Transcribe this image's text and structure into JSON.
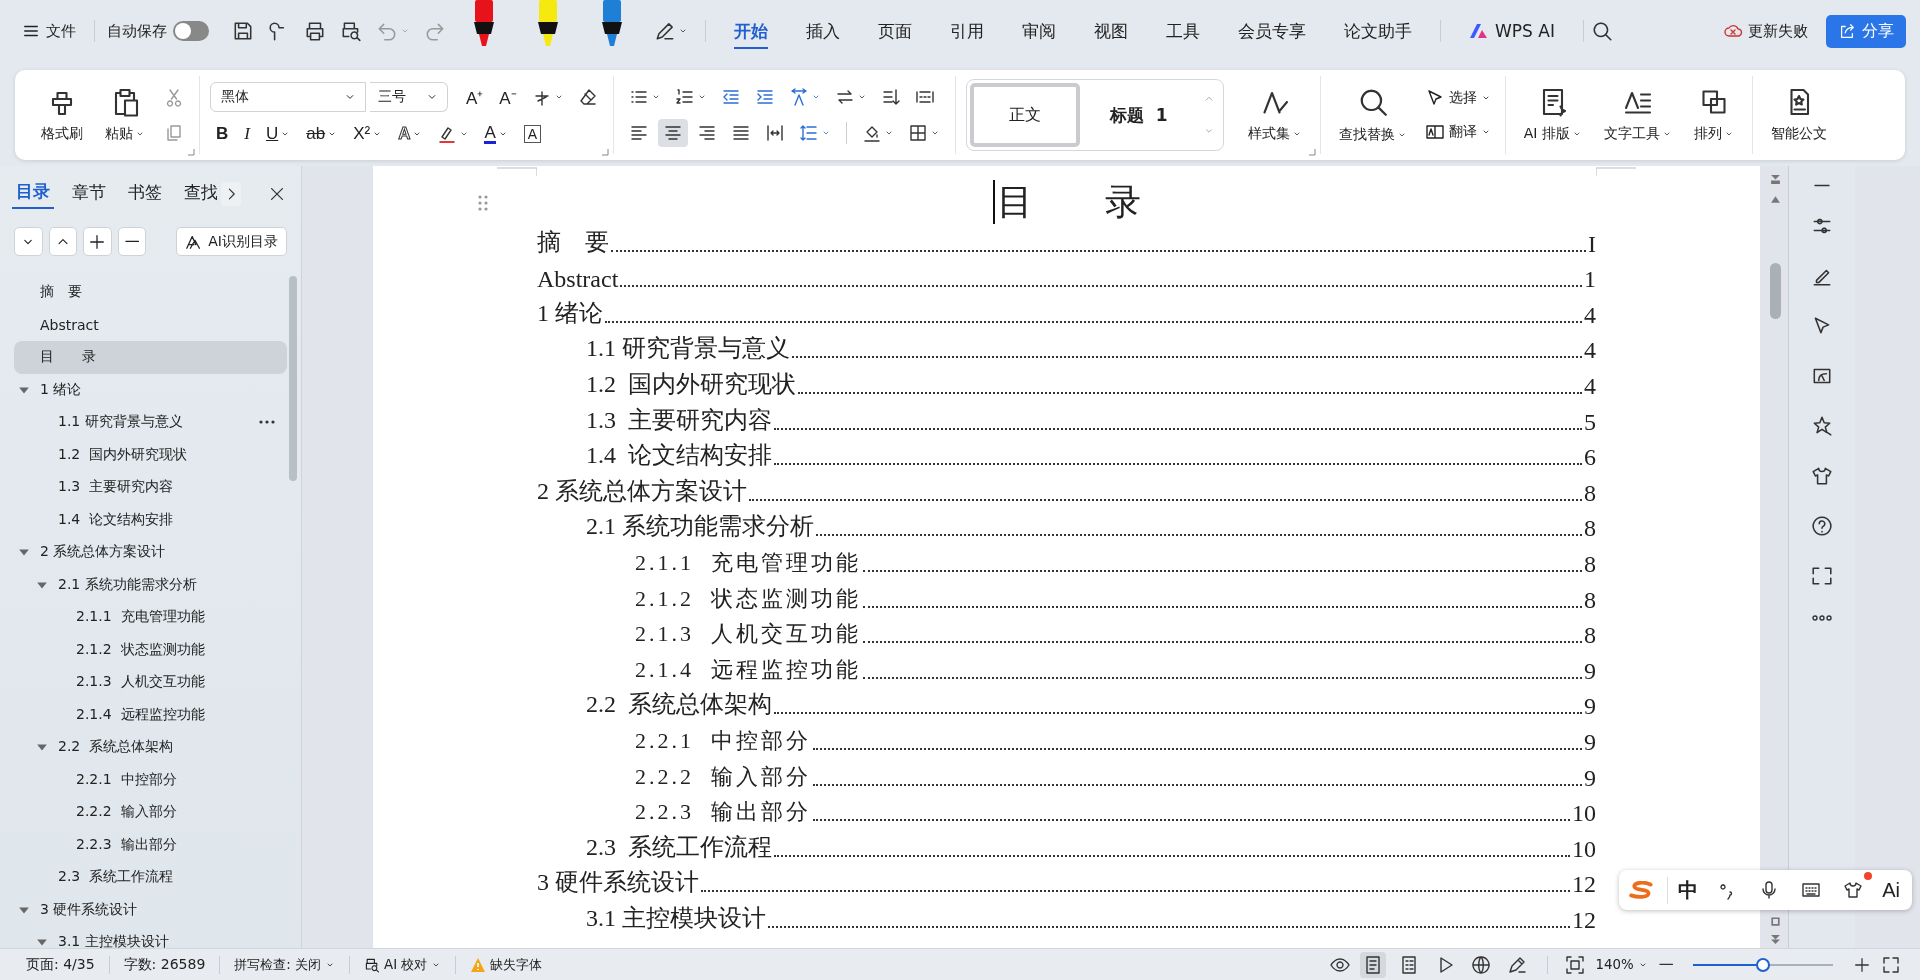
{
  "topbar": {
    "menu": "文件",
    "autosave": {
      "label": "自动保存",
      "on": false
    },
    "pens": [
      {
        "color": "#e8121b"
      },
      {
        "color": "#f5e90f"
      },
      {
        "color": "#1f7fd6"
      }
    ],
    "tabs": [
      {
        "label": "开始",
        "kind": "text",
        "selected": true
      },
      {
        "label": "插入",
        "kind": "text",
        "selected": false
      },
      {
        "label": "页面",
        "kind": "text",
        "selected": false
      },
      {
        "label": "引用",
        "kind": "text",
        "selected": false
      },
      {
        "label": "审阅",
        "kind": "text",
        "selected": false
      },
      {
        "label": "视图",
        "kind": "text",
        "selected": false
      },
      {
        "label": "工具",
        "kind": "text",
        "selected": false
      },
      {
        "label": "会员专享",
        "kind": "text",
        "selected": false
      },
      {
        "label": "论文助手",
        "kind": "text",
        "selected": false
      },
      {
        "label": "WPS AI",
        "kind": "ai",
        "selected": false
      }
    ],
    "sync_status": "更新失败",
    "share": "分享"
  },
  "ribbon": {
    "format_painter": "格式刷",
    "paste": "粘贴",
    "font": {
      "value": "黑体"
    },
    "size": {
      "value": "三号"
    },
    "size_buttons": [
      {
        "text": "A⁺"
      },
      {
        "text": "A⁻"
      }
    ],
    "font_buttons": [
      {
        "kind": "bold",
        "text": "B"
      },
      {
        "kind": "italic",
        "text": "I"
      },
      {
        "kind": "underline",
        "text": "U"
      },
      {
        "kind": "strike",
        "text": "ab"
      },
      {
        "kind": "superscript",
        "text": "X²"
      },
      {
        "kind": "outline",
        "text": "A"
      },
      {
        "kind": "highlight"
      },
      {
        "kind": "color",
        "text": "A"
      },
      {
        "kind": "border",
        "text": "A"
      }
    ],
    "alignment": [
      {
        "kind": "left",
        "selected": false
      },
      {
        "kind": "center",
        "selected": true
      },
      {
        "kind": "right",
        "selected": false
      },
      {
        "kind": "justify",
        "selected": false
      },
      {
        "kind": "distributed",
        "selected": false
      }
    ],
    "styles": [
      {
        "label": "正文",
        "kind": "normal",
        "selected": true
      },
      {
        "label": "标题  1",
        "kind": "heading",
        "selected": false
      }
    ],
    "style_set": "样式集",
    "find_replace": "查找替换",
    "select": "选择",
    "translate": "翻译",
    "ai_layout": "AI 排版",
    "text_tools": "文字工具",
    "arrange": "排列",
    "smart_doc": "智能公文"
  },
  "sidebar": {
    "tabs": [
      {
        "label": "目录",
        "selected": true
      },
      {
        "label": "章节",
        "selected": false
      },
      {
        "label": "书签",
        "selected": false
      },
      {
        "label": "查找",
        "selected": false
      }
    ],
    "ai_button": "AI识别目录",
    "items": [
      {
        "label": "摘　要",
        "selected": false,
        "hovered": false
      },
      {
        "label": "Abstract",
        "selected": false,
        "hovered": false
      },
      {
        "label": "目　　录",
        "selected": true,
        "hovered": false
      },
      {
        "label": "1 绪论",
        "selected": false,
        "hovered": false,
        "expanded": true,
        "children": [
          {
            "label": "1.1 研究背景与意义",
            "selected": false,
            "hovered": true
          },
          {
            "label": "1.2  国内外研究现状",
            "selected": false,
            "hovered": false
          },
          {
            "label": "1.3  主要研究内容",
            "selected": false,
            "hovered": false
          },
          {
            "label": "1.4  论文结构安排",
            "selected": false,
            "hovered": false
          }
        ]
      },
      {
        "label": "2 系统总体方案设计",
        "selected": false,
        "hovered": false,
        "expanded": true,
        "children": [
          {
            "label": "2.1 系统功能需求分析",
            "selected": false,
            "hovered": false,
            "expanded": true,
            "children": [
              {
                "label": "2.1.1  充电管理功能",
                "selected": false,
                "hovered": false
              },
              {
                "label": "2.1.2  状态监测功能",
                "selected": false,
                "hovered": false
              },
              {
                "label": "2.1.3  人机交互功能",
                "selected": false,
                "hovered": false
              },
              {
                "label": "2.1.4  远程监控功能",
                "selected": false,
                "hovered": false
              }
            ]
          },
          {
            "label": "2.2  系统总体架构",
            "selected": false,
            "hovered": false,
            "expanded": true,
            "children": [
              {
                "label": "2.2.1  中控部分",
                "selected": false,
                "hovered": false
              },
              {
                "label": "2.2.2  输入部分",
                "selected": false,
                "hovered": false
              },
              {
                "label": "2.2.3  输出部分",
                "selected": false,
                "hovered": false
              }
            ]
          },
          {
            "label": "2.3  系统工作流程",
            "selected": false,
            "hovered": false
          }
        ]
      },
      {
        "label": "3 硬件系统设计",
        "selected": false,
        "hovered": false,
        "expanded": true,
        "children": [
          {
            "label": "3.1 主控模块设计",
            "selected": false,
            "hovered": false,
            "expanded": true
          }
        ]
      }
    ]
  },
  "document": {
    "title": "目　　录",
    "toc": [
      {
        "text": "摘　要",
        "page": "I"
      },
      {
        "text": "Abstract",
        "page": "1"
      },
      {
        "text": "1 绪论",
        "page": "4",
        "children": [
          {
            "text": "1.1 研究背景与意义",
            "page": "4"
          },
          {
            "text": "1.2  国内外研究现状",
            "page": "4"
          },
          {
            "text": "1.3  主要研究内容",
            "page": "5"
          },
          {
            "text": "1.4  论文结构安排",
            "page": "6"
          }
        ]
      },
      {
        "text": "2 系统总体方案设计",
        "page": "8",
        "children": [
          {
            "text": "2.1 系统功能需求分析",
            "page": "8",
            "children": [
              {
                "text": "2.1.1  充电管理功能",
                "page": "8"
              },
              {
                "text": "2.1.2  状态监测功能",
                "page": "8"
              },
              {
                "text": "2.1.3  人机交互功能",
                "page": "8"
              },
              {
                "text": "2.1.4  远程监控功能",
                "page": "9"
              }
            ]
          },
          {
            "text": "2.2  系统总体架构",
            "page": "9",
            "children": [
              {
                "text": "2.2.1  中控部分",
                "page": "9"
              },
              {
                "text": "2.2.2  输入部分",
                "page": "9"
              },
              {
                "text": "2.2.3  输出部分",
                "page": "10"
              }
            ]
          },
          {
            "text": "2.3  系统工作流程",
            "page": "10"
          }
        ]
      },
      {
        "text": "3 硬件系统设计",
        "page": "12",
        "children": [
          {
            "text": "3.1 主控模块设计",
            "page": "12"
          }
        ]
      }
    ]
  },
  "ime": {
    "language": "中",
    "ai": "Ai"
  },
  "statusbar": {
    "page": "页面: 4/35",
    "words": "字数: 26589",
    "spellcheck": "拼写检查: 关闭",
    "proofread": "AI 校对",
    "missing_fonts": "缺失字体",
    "views": [
      {
        "kind": "page",
        "selected": true
      },
      {
        "kind": "outline",
        "selected": false
      },
      {
        "kind": "play",
        "selected": false
      },
      {
        "kind": "web",
        "selected": false
      },
      {
        "kind": "pen",
        "selected": false
      }
    ],
    "zoom": "140%",
    "zoom_slider": {
      "level": 0.5
    }
  }
}
